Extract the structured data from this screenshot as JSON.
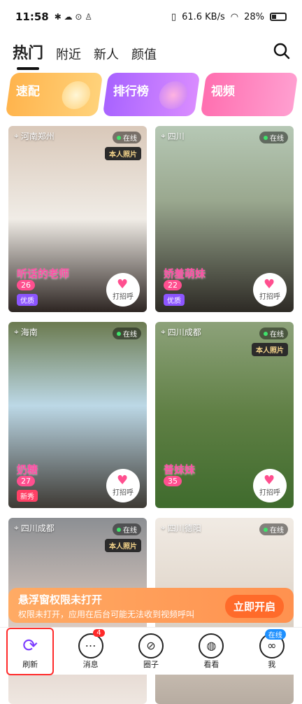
{
  "status": {
    "time": "11:58",
    "speed": "61.6 KB/s",
    "battery": "28%"
  },
  "tabs": [
    {
      "label": "热门"
    },
    {
      "label": "附近"
    },
    {
      "label": "新人"
    },
    {
      "label": "颜值"
    }
  ],
  "banners": [
    {
      "label": "速配"
    },
    {
      "label": "排行榜"
    },
    {
      "label": "视频"
    }
  ],
  "cards": [
    {
      "location": "河南郑州",
      "online": "在线",
      "verified": "本人照片",
      "name": "听话的老师",
      "likes": "26",
      "tag": "优质"
    },
    {
      "location": "四川",
      "online": "在线",
      "verified": "",
      "name": "娇羞萌妹",
      "likes": "22",
      "tag": "优质"
    },
    {
      "location": "海南",
      "online": "在线",
      "verified": "",
      "name": "奶糖",
      "likes": "27",
      "tag": "新秀"
    },
    {
      "location": "四川成都",
      "online": "在线",
      "verified": "本人照片",
      "name": "普妹妹",
      "likes": "35",
      "tag": ""
    },
    {
      "location": "四川成都",
      "online": "在线",
      "verified": "本人照片"
    },
    {
      "location": "四川德阳",
      "online": "在线",
      "verified": ""
    }
  ],
  "greet_label": "打招呼",
  "notify": {
    "title": "悬浮窗权限未打开",
    "subtitle": "权限未打开，应用在后台可能无法收到视频呼叫",
    "button": "立即开启"
  },
  "nav": [
    {
      "label": "刷新",
      "icon": "refresh-icon",
      "badge": ""
    },
    {
      "label": "消息",
      "icon": "chat-icon",
      "badge": "4"
    },
    {
      "label": "圈子",
      "icon": "compass-icon",
      "badge": ""
    },
    {
      "label": "看看",
      "icon": "planet-icon",
      "badge": ""
    },
    {
      "label": "我",
      "icon": "profile-icon",
      "badge": "在线"
    }
  ]
}
